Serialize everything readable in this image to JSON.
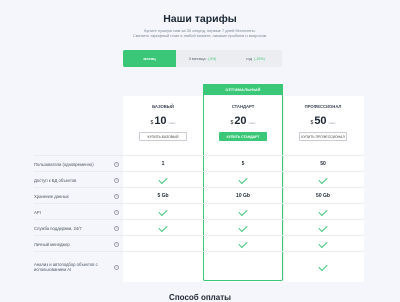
{
  "header": {
    "title": "Наши тарифы",
    "subtitle_line1": "Купите нужную нам за 30 секунд, первые 7 дней бесплатно.",
    "subtitle_line2": "Сменить тарифный план в любой момент, никаких проблем и вопросов."
  },
  "period_tabs": [
    {
      "label": "месяц",
      "discount": "",
      "active": true
    },
    {
      "label": "3 месяца",
      "discount": "(-5%)",
      "active": false
    },
    {
      "label": "год",
      "discount": "(-15%)",
      "active": false
    }
  ],
  "featured_banner": "ОПТИМАЛЬНЫЙ",
  "plans": [
    {
      "name": "БАЗОВЫЙ",
      "currency": "$",
      "price": "10",
      "period": "/ мес",
      "button": "КУПИТЬ БАЗОВЫЙ",
      "primary": false
    },
    {
      "name": "СТАНДАРТ",
      "currency": "$",
      "price": "20",
      "period": "/ мес",
      "button": "КУПИТЬ СТАНДАРТ",
      "primary": true
    },
    {
      "name": "ПРОФЕССИОНАЛ",
      "currency": "$",
      "price": "50",
      "period": "/ мес",
      "button": "КУПИТЬ ПРОФЕССИОНАЛ",
      "primary": false
    }
  ],
  "features": [
    {
      "label": "Пользователи (одновременно)",
      "values": [
        "1",
        "5",
        "50"
      ]
    },
    {
      "label": "Доступ к БД объектов",
      "values": [
        "check",
        "check",
        "check"
      ]
    },
    {
      "label": "Хранение данных",
      "values": [
        "5 Gb",
        "10 Gb",
        "50 Gb"
      ]
    },
    {
      "label": "API",
      "values": [
        "check",
        "check",
        "check"
      ]
    },
    {
      "label": "Служба поддержки, 24/7",
      "values": [
        "check",
        "check",
        "check"
      ]
    },
    {
      "label": "Личный менеджер",
      "values": [
        "",
        "check",
        "check"
      ]
    },
    {
      "label": "Анализ и автоподбор объектов с использованием AI",
      "values": [
        "",
        "",
        "check"
      ]
    }
  ],
  "info_icon_glyph": "?",
  "payment_title": "Способ оплаты",
  "colors": {
    "accent": "#3ac777",
    "background": "#f4f6fb"
  }
}
